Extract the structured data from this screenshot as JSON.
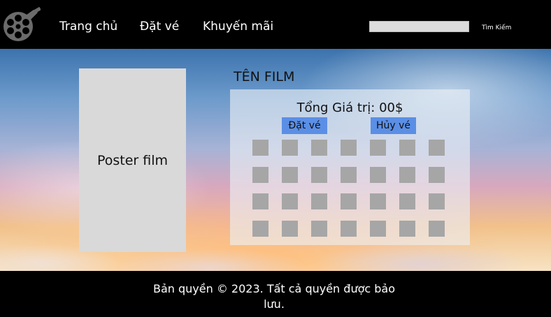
{
  "header": {
    "nav": [
      "Trang chủ",
      "Đặt vé",
      "Khuyến mãi"
    ],
    "search": {
      "value": "",
      "placeholder": "",
      "button_label": "Tìm Kiếm"
    }
  },
  "main": {
    "poster_label": "Poster film",
    "film_title": "TÊN FILM",
    "total_label": "Tổng Giá trị: 00$",
    "book_button": "Đặt vé",
    "cancel_button": "Hủy vé",
    "seat_grid": {
      "rows": 4,
      "columns": 7
    }
  },
  "footer": {
    "copyright": "Bản quyền © 2023. Tất cả quyền được bảo lưu."
  },
  "colors": {
    "header_bg": "#000000",
    "poster_bg": "#d9d9d9",
    "button_bg": "#5b8fe6",
    "seat": "#a6a6a6"
  }
}
